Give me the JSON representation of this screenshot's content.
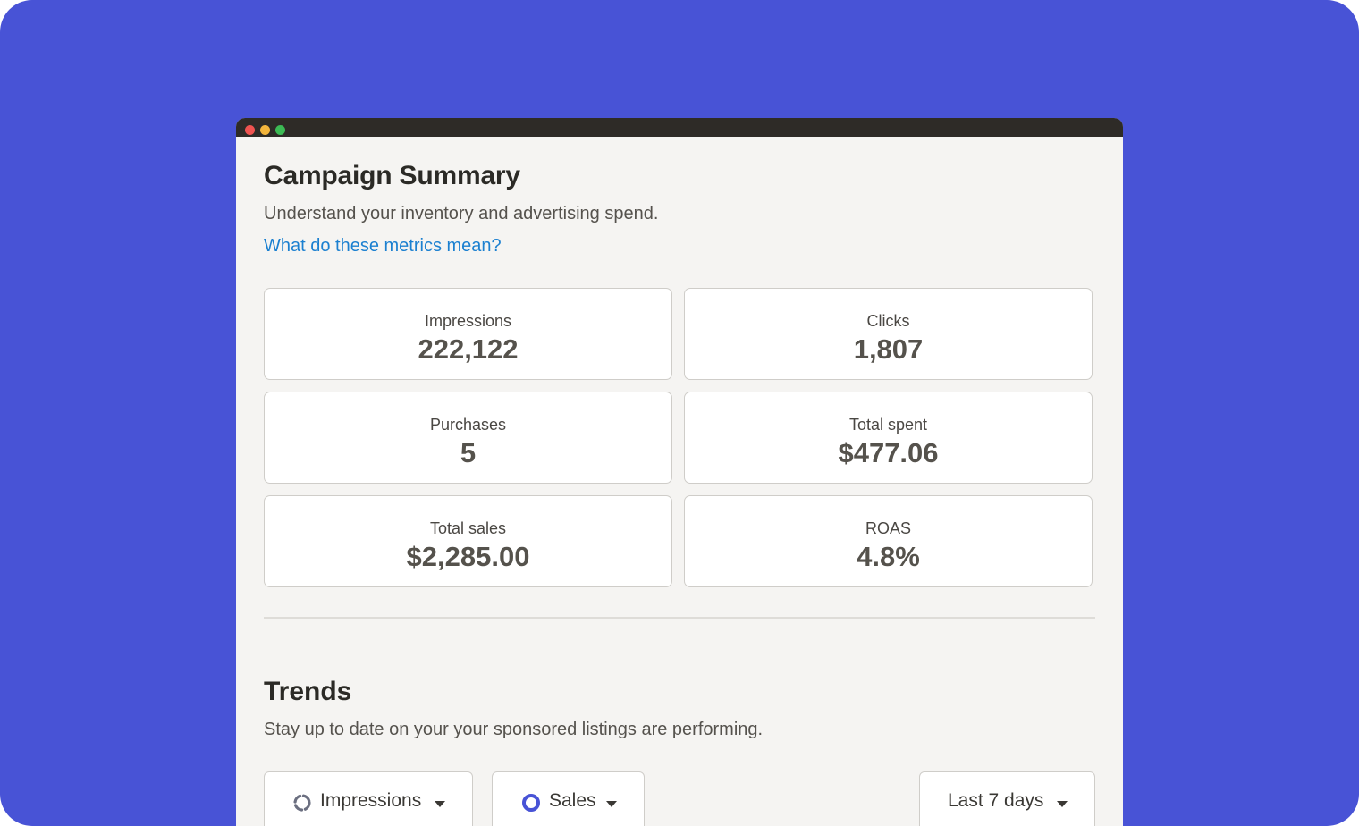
{
  "campaign": {
    "title": "Campaign Summary",
    "subtitle": "Understand your inventory and advertising spend.",
    "help_link": "What do these metrics mean?"
  },
  "metrics": [
    {
      "label": "Impressions",
      "value": "222,122"
    },
    {
      "label": "Clicks",
      "value": "1,807"
    },
    {
      "label": "Purchases",
      "value": "5"
    },
    {
      "label": "Total spent",
      "value": "$477.06"
    },
    {
      "label": "Total sales",
      "value": "$2,285.00"
    },
    {
      "label": "ROAS",
      "value": "4.8%"
    }
  ],
  "trends": {
    "title": "Trends",
    "subtitle": "Stay up to date on your your sponsored listings are performing.",
    "metric_select": {
      "label": "Impressions",
      "icon": "dashed-ring-icon"
    },
    "series_select": {
      "label": "Sales",
      "icon": "ring-icon"
    },
    "range_select": {
      "label": "Last 7 days"
    }
  },
  "colors": {
    "background": "#4853d6",
    "link": "#1c80d0",
    "series_accent": "#4853d6"
  }
}
